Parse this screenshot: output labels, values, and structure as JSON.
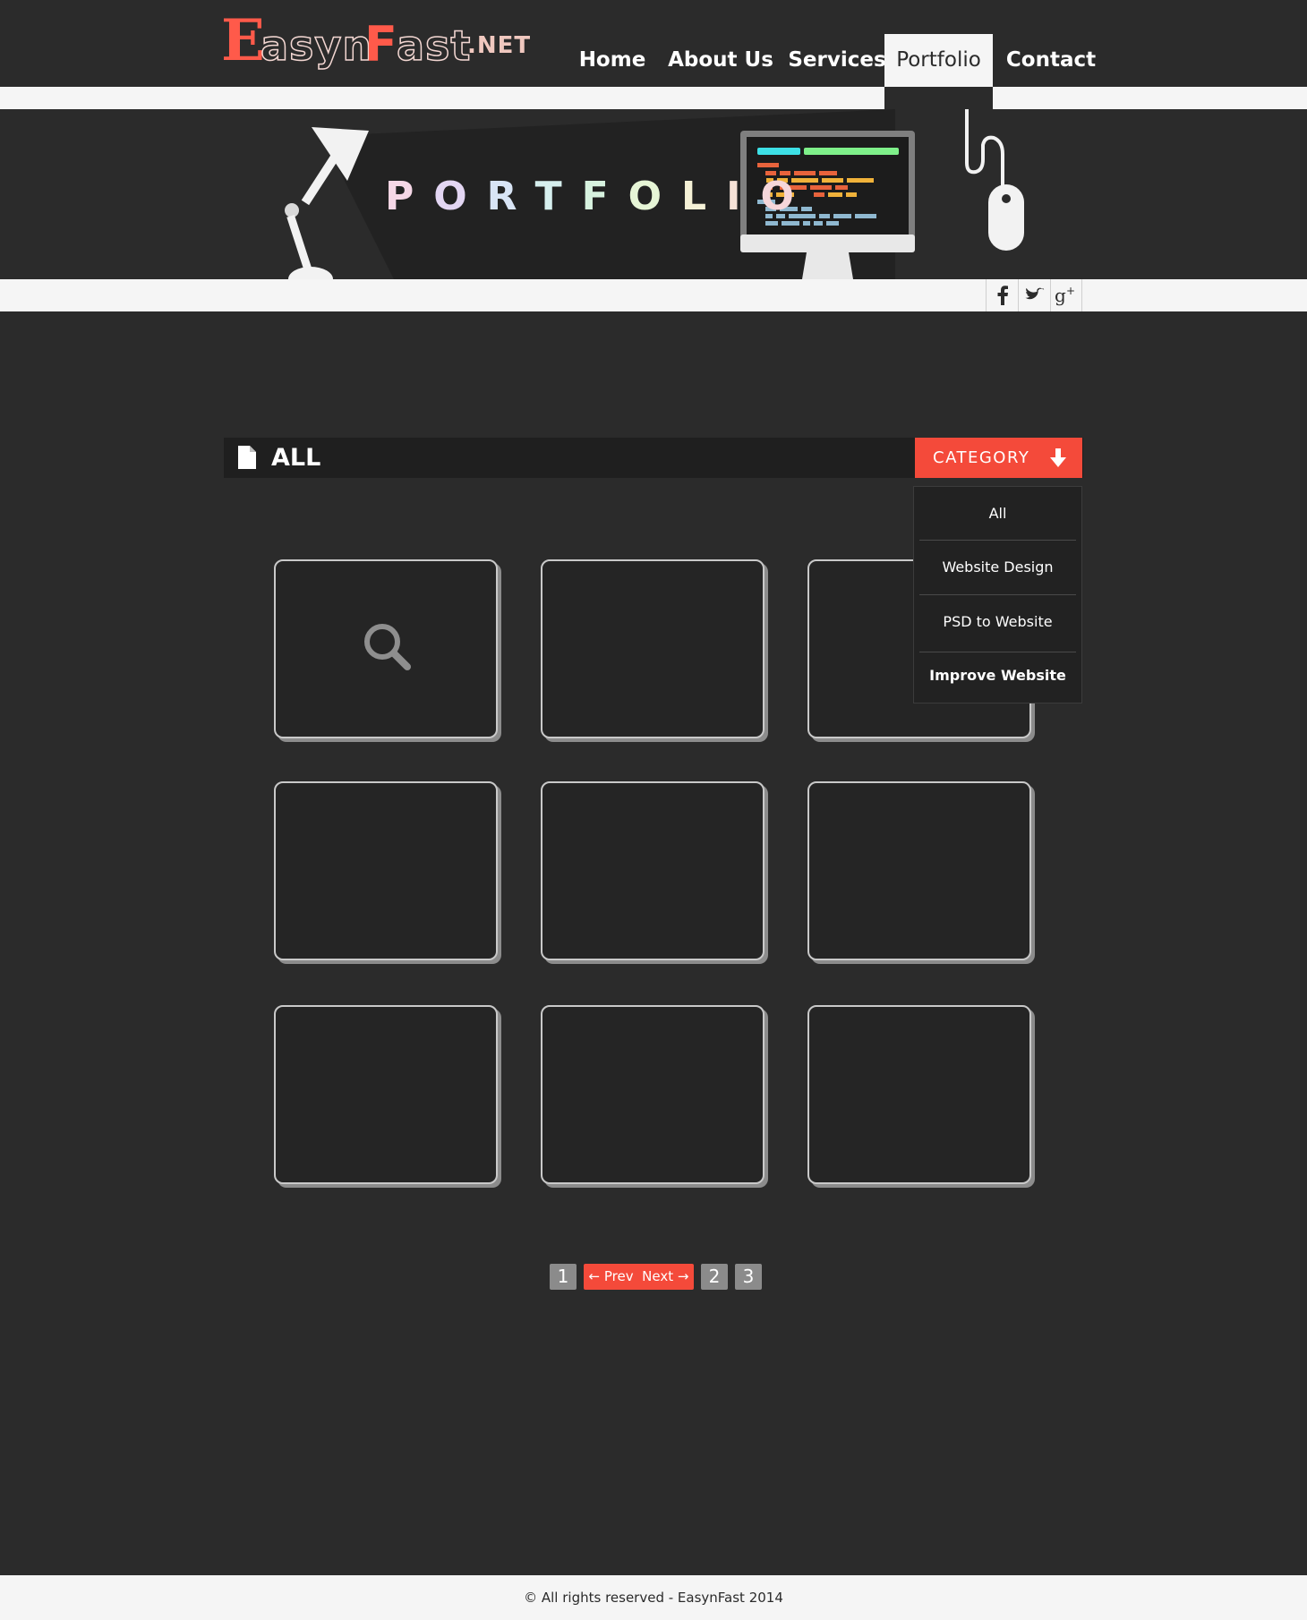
{
  "brand": {
    "logo_cap_e": "E",
    "logo_word_a": "asyn",
    "logo_cap_f": "F",
    "logo_word_b": "ast",
    "logo_tld": ".NET",
    "accent_color": "#f44a3a"
  },
  "nav": {
    "items": [
      {
        "label": "Home",
        "active": false
      },
      {
        "label": "About Us",
        "active": false
      },
      {
        "label": "Services",
        "active": false
      },
      {
        "label": "Portfolio",
        "active": true
      },
      {
        "label": "Contact",
        "active": false
      }
    ]
  },
  "banner": {
    "title_letters": [
      "P",
      "O",
      "R",
      "T",
      "F",
      "O",
      "L",
      "I",
      "O"
    ]
  },
  "social": [
    {
      "icon": "facebook-icon",
      "glyph": "f"
    },
    {
      "icon": "twitter-icon",
      "glyph": "t"
    },
    {
      "icon": "google-plus-icon",
      "glyph": "g+"
    }
  ],
  "filter": {
    "title": "ALL",
    "category_label": "CATEGORY",
    "dropdown": [
      "All",
      "Website Design",
      "PSD to Website",
      "Improve Website"
    ]
  },
  "grid": {
    "item_count": 9,
    "hover_item_icon": "search-icon"
  },
  "pagination": {
    "current": "1",
    "prev_label": "← Prev",
    "next_label": "Next →",
    "pages": [
      "2",
      "3"
    ]
  },
  "footer": {
    "text": "© All rights reserved - EasynFast 2014"
  }
}
